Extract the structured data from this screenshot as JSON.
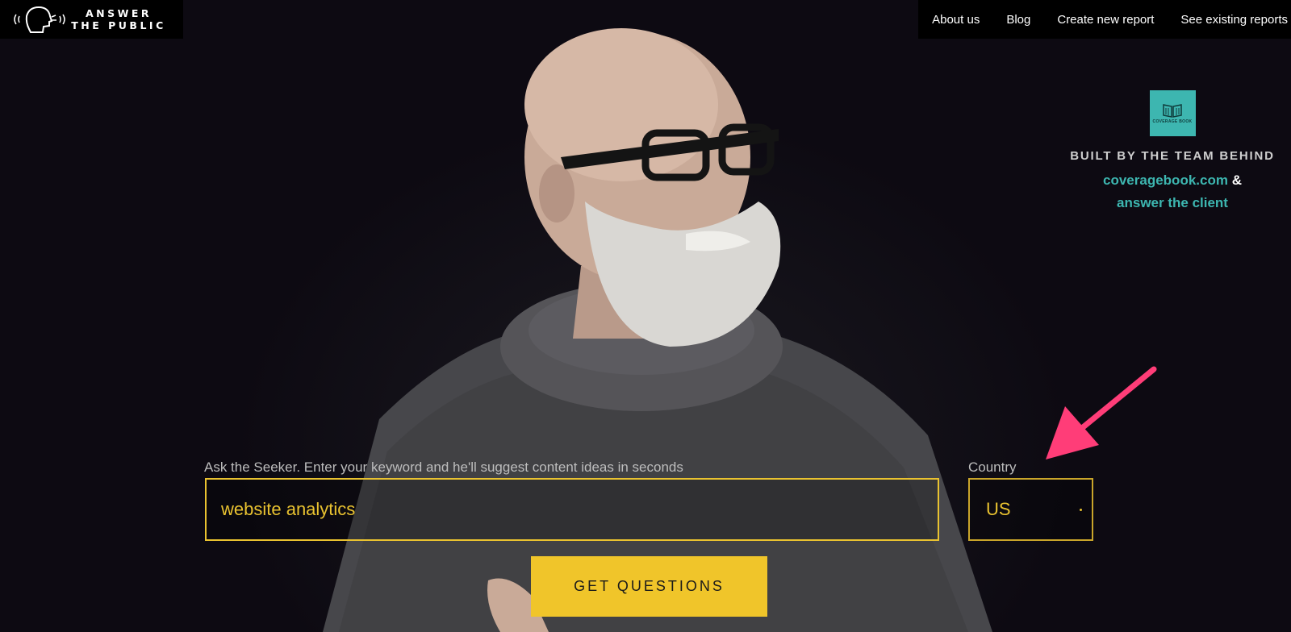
{
  "brand": {
    "name_line1": "ANSWER",
    "name_line2": "THE PUBLIC",
    "logo_icon": "speaking-head-icon"
  },
  "nav": {
    "items": [
      {
        "label": "About us"
      },
      {
        "label": "Blog"
      },
      {
        "label": "Create new report"
      },
      {
        "label": "See existing reports"
      }
    ]
  },
  "promo": {
    "logo_label": "COVERAGE BOOK",
    "built_by": "BUILT BY THE TEAM BEHIND",
    "link1": "coveragebook.com",
    "amp": "&",
    "link2": "answer the client",
    "accent_color": "#3db6b0"
  },
  "search": {
    "label": "Ask the Seeker. Enter your keyword and he'll suggest content ideas in seconds",
    "value": "website analytics",
    "border_color": "#e9c230"
  },
  "country": {
    "label": "Country",
    "selected": "US"
  },
  "submit": {
    "label": "GET QUESTIONS",
    "color": "#f0c52a"
  },
  "annotation": {
    "arrow_color": "#ff3d78",
    "arrow_icon": "pointer-arrow-icon"
  }
}
